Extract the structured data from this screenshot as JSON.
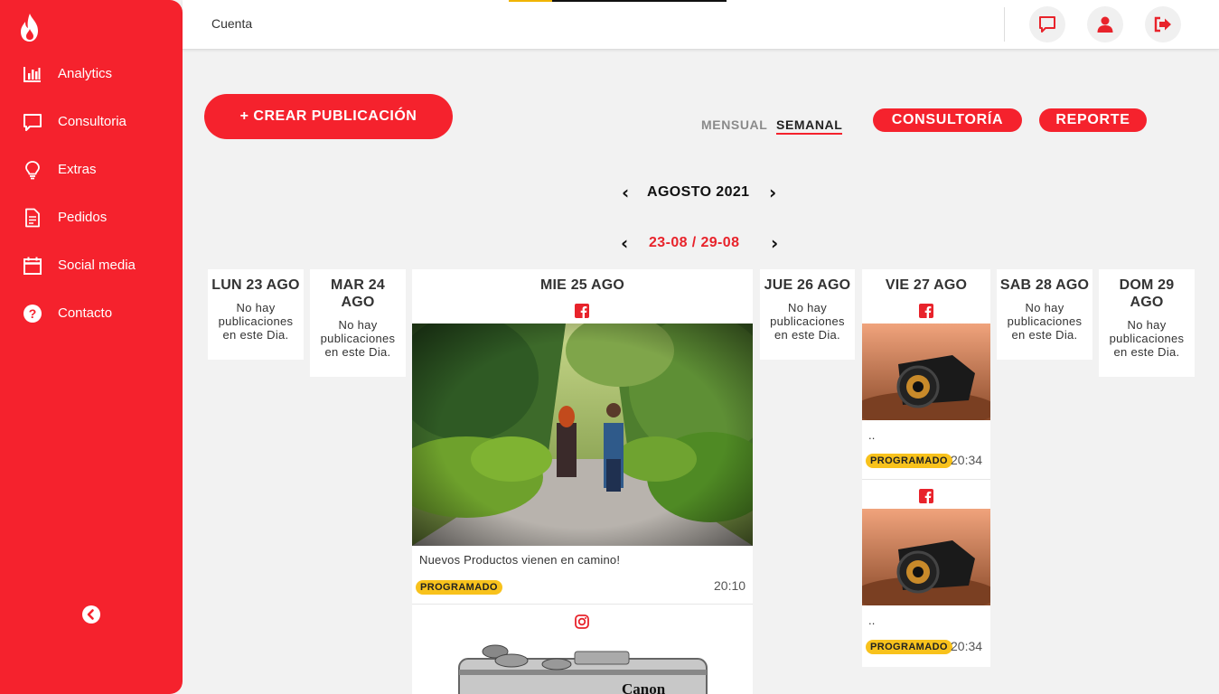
{
  "sidebar": {
    "items": [
      {
        "label": "Analytics",
        "icon": "bar-chart-icon"
      },
      {
        "label": "Consultoria",
        "icon": "chat-icon"
      },
      {
        "label": "Extras",
        "icon": "lightbulb-icon"
      },
      {
        "label": "Pedidos",
        "icon": "document-icon"
      },
      {
        "label": "Social media",
        "icon": "calendar-icon"
      },
      {
        "label": "Contacto",
        "icon": "help-icon"
      }
    ],
    "collapse_icon": "chevron-left-circle-icon",
    "logo_icon": "flame-logo-icon",
    "accent": "#f5222d"
  },
  "topbar": {
    "breadcrumb": "Cuenta",
    "icons": [
      "message-icon",
      "user-icon",
      "logout-icon"
    ]
  },
  "toolbar": {
    "create_label": "+ CREAR PUBLICACIÓN",
    "view_monthly": "MENSUAL",
    "view_weekly": "SEMANAL",
    "consultoria_label": "CONSULTORÍA",
    "reporte_label": "REPORTE"
  },
  "calendar": {
    "month_label": "AGOSTO 2021",
    "week_label": "23-08 / 29-08",
    "days": [
      {
        "title": "LUN 23 AGO",
        "empty": "No hay publicaciones en este Dia."
      },
      {
        "title": "MAR 24 AGO",
        "empty": "No hay publicaciones en este Dia."
      },
      {
        "title": "MIE 25 AGO",
        "empty": ""
      },
      {
        "title": "JUE 26 AGO",
        "empty": "No hay publicaciones en este Dia."
      },
      {
        "title": "VIE 27 AGO",
        "empty": ""
      },
      {
        "title": "SAB 28 AGO",
        "empty": "No hay publicaciones en este Dia."
      },
      {
        "title": "DOM 29 AGO",
        "empty": "No hay publicaciones en este Dia."
      }
    ],
    "posts": {
      "wed_1": {
        "network": "facebook",
        "caption": "Nuevos Productos vienen en camino!",
        "status": "PROGRAMADO",
        "time": "20:10"
      },
      "wed_2": {
        "network": "instagram"
      },
      "fri_1": {
        "network": "facebook",
        "caption": "..",
        "status": "PROGRAMADO",
        "time": "20:34"
      },
      "fri_2": {
        "network": "facebook",
        "caption": "..",
        "status": "PROGRAMADO",
        "time": "20:34"
      }
    },
    "status_color": "#f8c21c"
  }
}
